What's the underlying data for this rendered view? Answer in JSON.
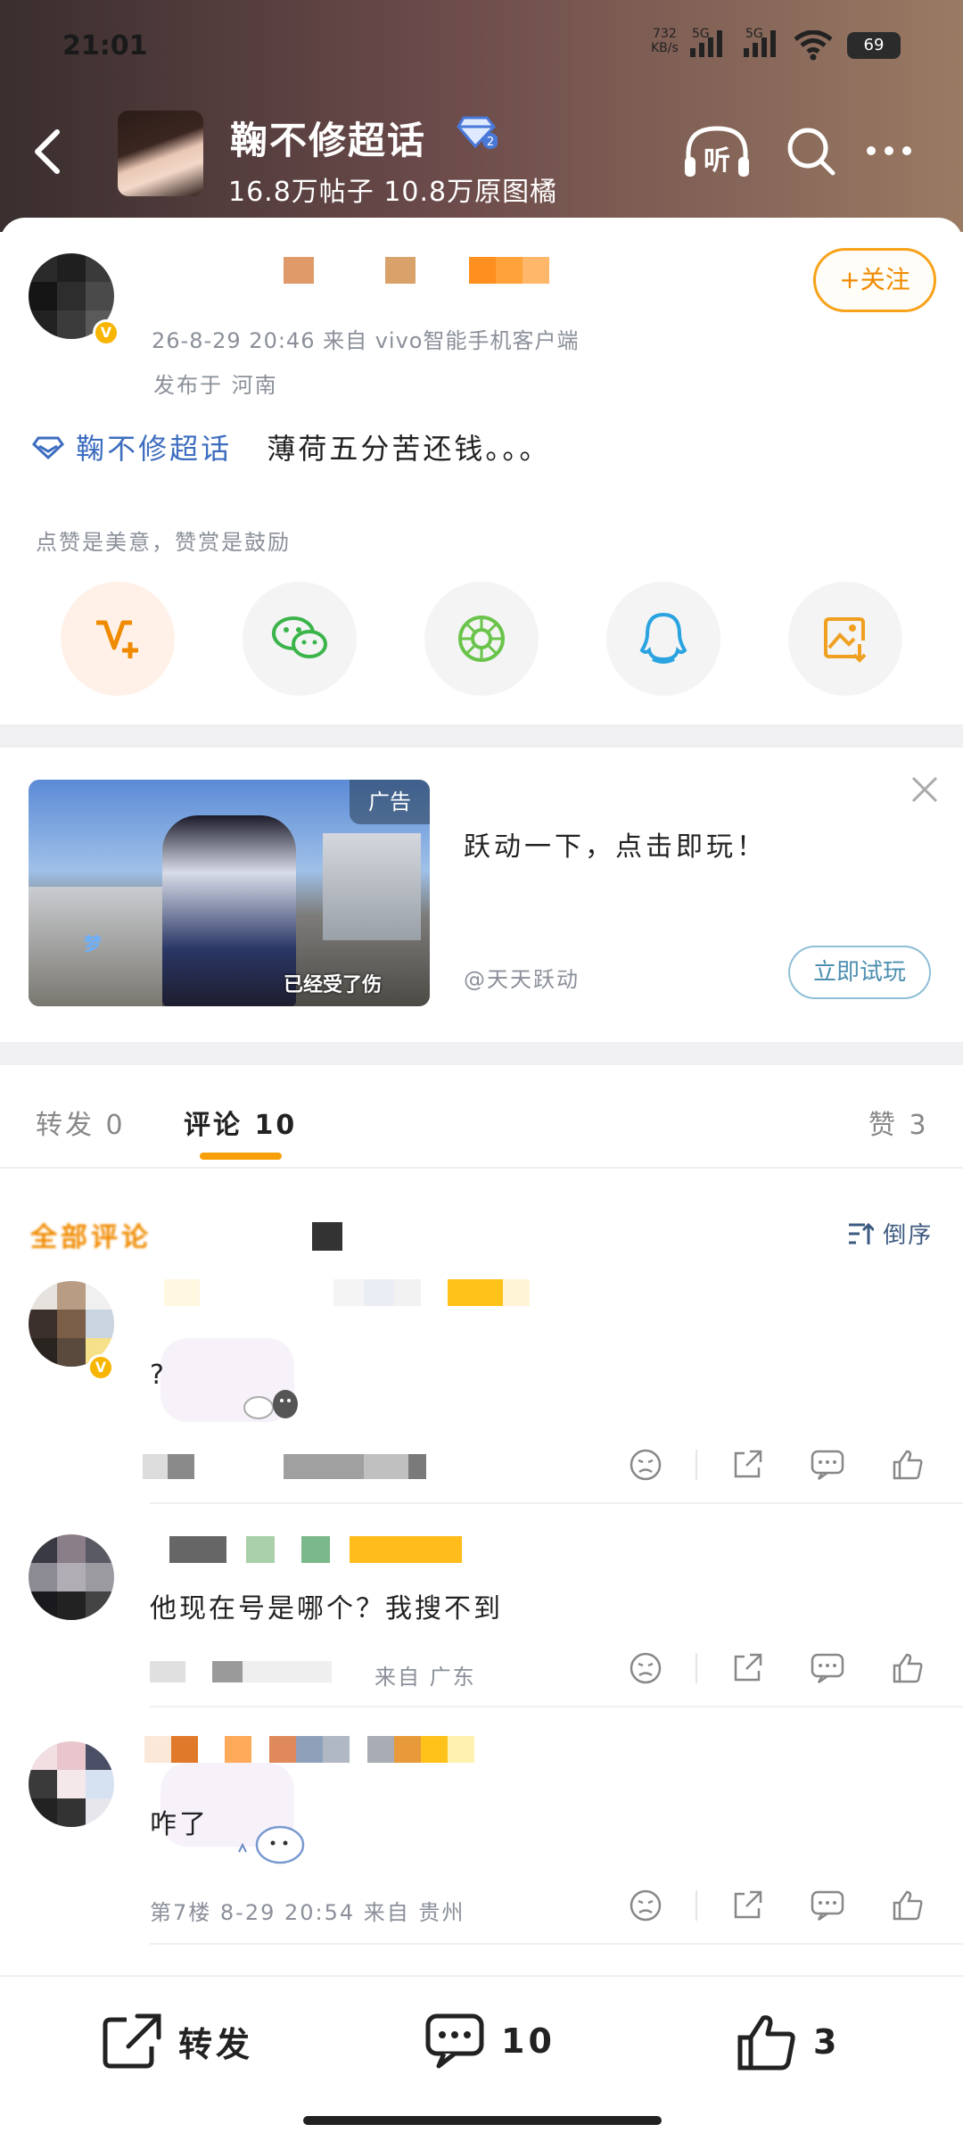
{
  "status_bar": {
    "time": "21:01",
    "net_speed": "732\nKB/s",
    "signal_label_1": "5G",
    "signal_label_2": "5G",
    "battery": "69"
  },
  "header": {
    "topic_title": "鞠不修超话",
    "stats": "16.8万帖子  10.8万原图橘",
    "listen_label": "听"
  },
  "post": {
    "meta": "26-8-29 20:46  来自 vivo智能手机客户端",
    "location": "发布于 河南",
    "follow_label": "+关注",
    "topic_link": "鞠不修超话",
    "text": "薄荷五分苦还钱。。。",
    "praise_tip": "点赞是美意，赞赏是鼓励"
  },
  "ad": {
    "tag": "广告",
    "title": "跃动一下，点击即玩！",
    "source": "@天天跃动",
    "try_label": "立即试玩",
    "image_caption": "已经受了伤",
    "image_name": "梦",
    "colors": {
      "accent": "#f79f0a",
      "link": "#3d6dbf"
    }
  },
  "tabs": {
    "repost": "转发 0",
    "comments": "评论 10",
    "likes": "赞 3"
  },
  "comments_header": {
    "all": "全部评论",
    "sort": "倒序"
  },
  "comments": [
    {
      "text": "?",
      "meta": ""
    },
    {
      "text": "他现在号是哪个？我搜不到",
      "meta": "来自 广东"
    },
    {
      "text": "咋了",
      "meta": "第7楼  8-29 20:54  来自 贵州"
    }
  ],
  "bottom_bar": {
    "repost_label": "转发",
    "comment_count": "10",
    "like_count": "3"
  }
}
